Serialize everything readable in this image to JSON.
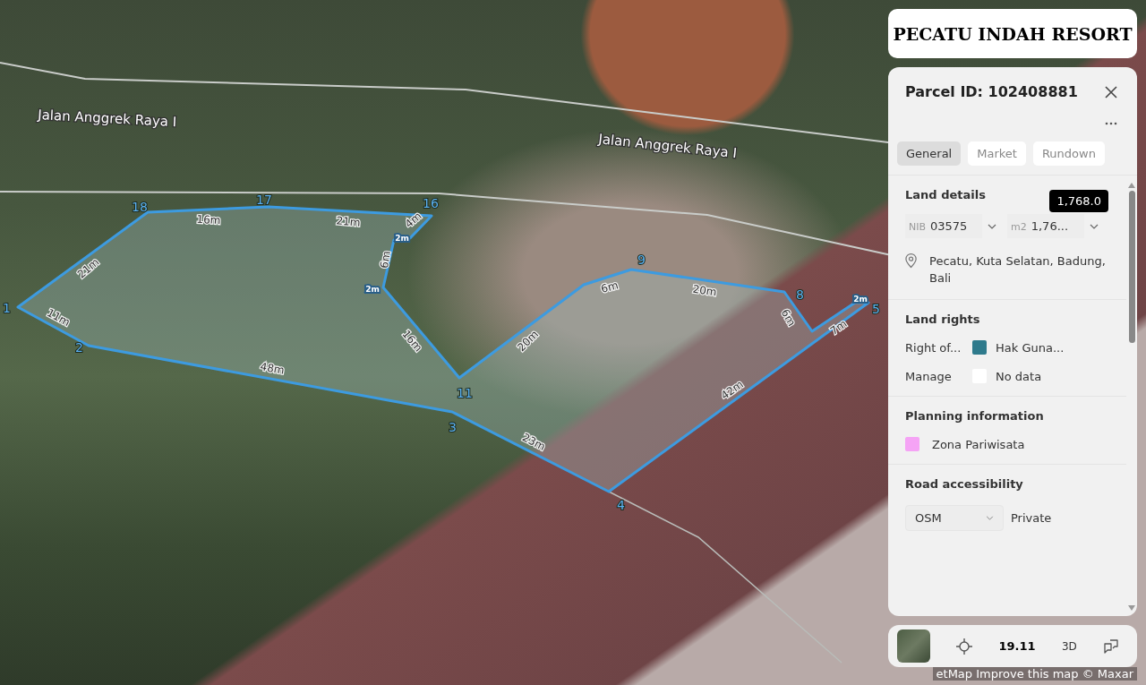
{
  "overlay_title": "PECATU INDAH RESORT",
  "map": {
    "streets": [
      {
        "label": "Jalan Anggrek Raya I"
      },
      {
        "label": "Jalan Anggrek Raya I"
      }
    ],
    "vertices": [
      {
        "label": "18"
      },
      {
        "label": "17"
      },
      {
        "label": "16"
      },
      {
        "label": "9"
      },
      {
        "label": "8"
      },
      {
        "label": "5"
      },
      {
        "label": "1"
      },
      {
        "label": "2"
      },
      {
        "label": "11"
      },
      {
        "label": "3"
      },
      {
        "label": "4"
      }
    ],
    "edges": [
      {
        "label": "11m"
      },
      {
        "label": "48m"
      },
      {
        "label": "23m"
      },
      {
        "label": "42m"
      },
      {
        "label": "2m"
      },
      {
        "label": "7m"
      },
      {
        "label": "6m"
      },
      {
        "label": "20m"
      },
      {
        "label": "6m"
      },
      {
        "label": "20m"
      },
      {
        "label": "16m"
      },
      {
        "label": "2m"
      },
      {
        "label": "6m"
      },
      {
        "label": "2m"
      },
      {
        "label": "4m"
      },
      {
        "label": "21m"
      },
      {
        "label": "16m"
      },
      {
        "label": "21m"
      }
    ],
    "attribution": "etMap Improve this map © Maxar"
  },
  "panel": {
    "title": "Parcel ID: 102408881",
    "tabs": [
      {
        "label": "General",
        "selected": true
      },
      {
        "label": "Market",
        "selected": false
      },
      {
        "label": "Rundown",
        "selected": false
      }
    ],
    "land_details": {
      "heading": "Land details",
      "tooltip": "1,768.0",
      "nib": {
        "prefix": "NIB",
        "value": "03575"
      },
      "area": {
        "prefix": "m2",
        "value": "1,76..."
      },
      "address": "Pecatu, Kuta Selatan, Badung, Bali"
    },
    "land_rights": {
      "heading": "Land rights",
      "rows": [
        {
          "label": "Right of...",
          "value": "Hak Guna...",
          "color": "#2e7a8c"
        },
        {
          "label": "Manage",
          "value": "No data",
          "color": "#ffffff"
        }
      ]
    },
    "planning": {
      "heading": "Planning information",
      "items": [
        {
          "label": "Zona Pariwisata",
          "color": "#f5a3f5"
        }
      ]
    },
    "road": {
      "heading": "Road accessibility",
      "source": "OSM",
      "value": "Private"
    }
  },
  "bottom_bar": {
    "zoom": "19.11",
    "mode": "3D"
  }
}
